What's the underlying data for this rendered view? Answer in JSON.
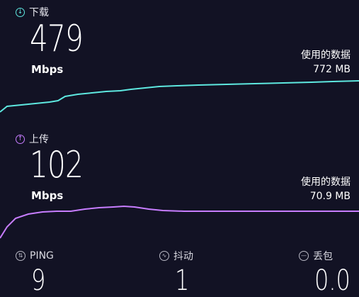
{
  "download": {
    "label": "下载",
    "value": "479",
    "unit": "Mbps",
    "usage_label": "使用的数据",
    "usage_value": "772 MB",
    "color": "#5ee8e0"
  },
  "upload": {
    "label": "上传",
    "value": "102",
    "unit": "Mbps",
    "usage_label": "使用的数据",
    "usage_value": "70.9 MB",
    "color": "#c77dff"
  },
  "stats": {
    "ping_label": "PING",
    "ping_value": "9",
    "jitter_label": "抖动",
    "jitter_value": "1",
    "loss_label": "丢包",
    "loss_value": "0.0"
  },
  "icons": {
    "download": "download-arrow-icon",
    "upload": "upload-arrow-icon",
    "ping": "ping-icon",
    "jitter": "jitter-wave-icon",
    "loss": "packet-loss-icon"
  }
}
